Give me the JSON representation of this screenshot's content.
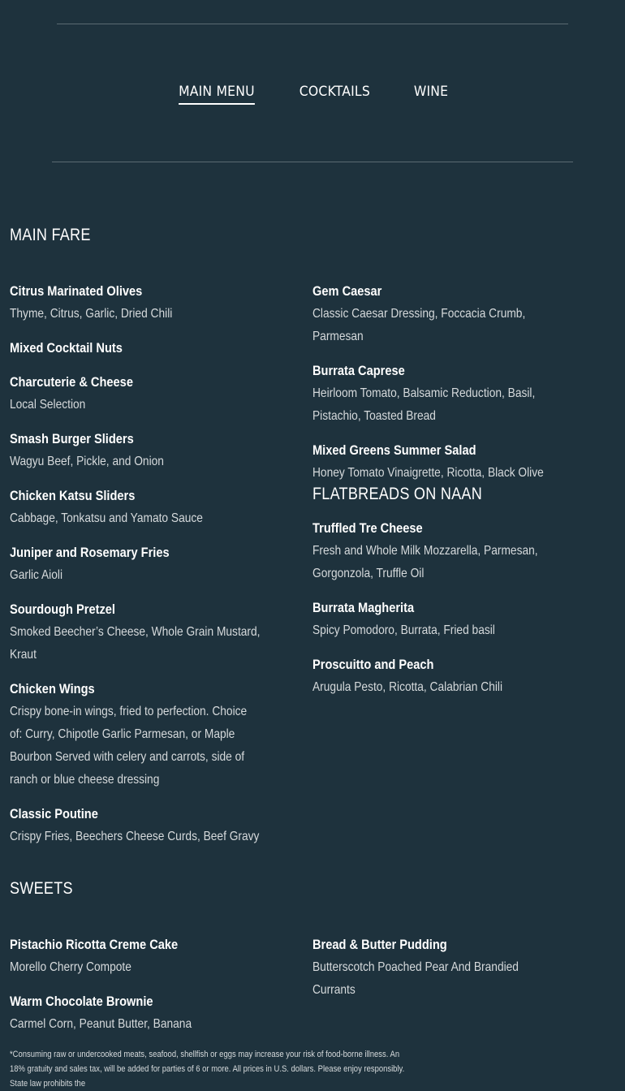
{
  "tabs": [
    {
      "label": "MAIN MENU",
      "active": true
    },
    {
      "label": "COCKTAILS",
      "active": false
    },
    {
      "label": "WINE",
      "active": false
    }
  ],
  "main_fare": {
    "title": "MAIN FARE",
    "left": [
      {
        "name": "Citrus Marinated Olives",
        "desc": "Thyme, Citrus, Garlic, Dried Chili"
      },
      {
        "name": "Mixed Cocktail Nuts",
        "desc": ""
      },
      {
        "name": "Charcuterie & Cheese",
        "desc": "Local Selection"
      },
      {
        "name": "Smash Burger Sliders",
        "desc": "Wagyu Beef, Pickle, and Onion"
      },
      {
        "name": "Chicken Katsu Sliders",
        "desc": "Cabbage, Tonkatsu and Yamato Sauce"
      },
      {
        "name": "Juniper and Rosemary Fries",
        "desc": "Garlic Aioli"
      },
      {
        "name": "Sourdough Pretzel",
        "desc": "Smoked Beecher’s Cheese, Whole Grain Mustard, Kraut"
      },
      {
        "name": "Chicken Wings",
        "desc": "Crispy bone-in wings, fried to perfection. Choice of: Curry, Chipotle Garlic Parmesan, or Maple Bourbon Served with celery and carrots, side of ranch or blue cheese dressing"
      },
      {
        "name": "Classic Poutine",
        "desc": "Crispy Fries, Beechers Cheese Curds, Beef Gravy"
      }
    ],
    "right": [
      {
        "name": "Gem Caesar",
        "desc": "Classic Caesar Dressing, Foccacia Crumb, Parmesan"
      },
      {
        "name": "Burrata Caprese",
        "desc": "Heirloom Tomato, Balsamic Reduction, Basil, Pistachio, Toasted Bread"
      },
      {
        "name": "Mixed Greens Summer Salad",
        "desc": "Honey Tomato Vinaigrette, Ricotta, Black Olive"
      }
    ]
  },
  "flatbreads": {
    "title": "FLATBREADS ON NAAN",
    "items": [
      {
        "name": "Truffled Tre Cheese",
        "desc": "Fresh and Whole Milk Mozzarella, Parmesan, Gorgonzola, Truffle Oil"
      },
      {
        "name": "Burrata Magherita",
        "desc": "Spicy Pomodoro, Burrata, Fried basil"
      },
      {
        "name": "Proscuitto and Peach",
        "desc": "Arugula Pesto, Ricotta, Calabrian Chili"
      }
    ]
  },
  "sweets": {
    "title": "SWEETS",
    "left": [
      {
        "name": "Pistachio Ricotta Creme Cake",
        "desc": "Morello Cherry Compote"
      },
      {
        "name": "Warm Chocolate Brownie",
        "desc": "Carmel Corn, Peanut Butter, Banana"
      }
    ],
    "right": [
      {
        "name": "Bread & Butter Pudding",
        "desc": "Butterscotch Poached Pear And Brandied Currants"
      }
    ]
  },
  "footnote": "*Consuming raw or undercooked meats, seafood, shellfish or eggs may increase your risk of food-borne illness. An 18% gratuity and sales tax, will be added for parties of 6 or more. All prices in U.S. dollars. Please enjoy responsibly. State law prohibits the",
  "colors": {
    "background": "#1e323d",
    "text": "#ffffff",
    "muted": "#d6dadc",
    "rule": "#5a6a72"
  }
}
